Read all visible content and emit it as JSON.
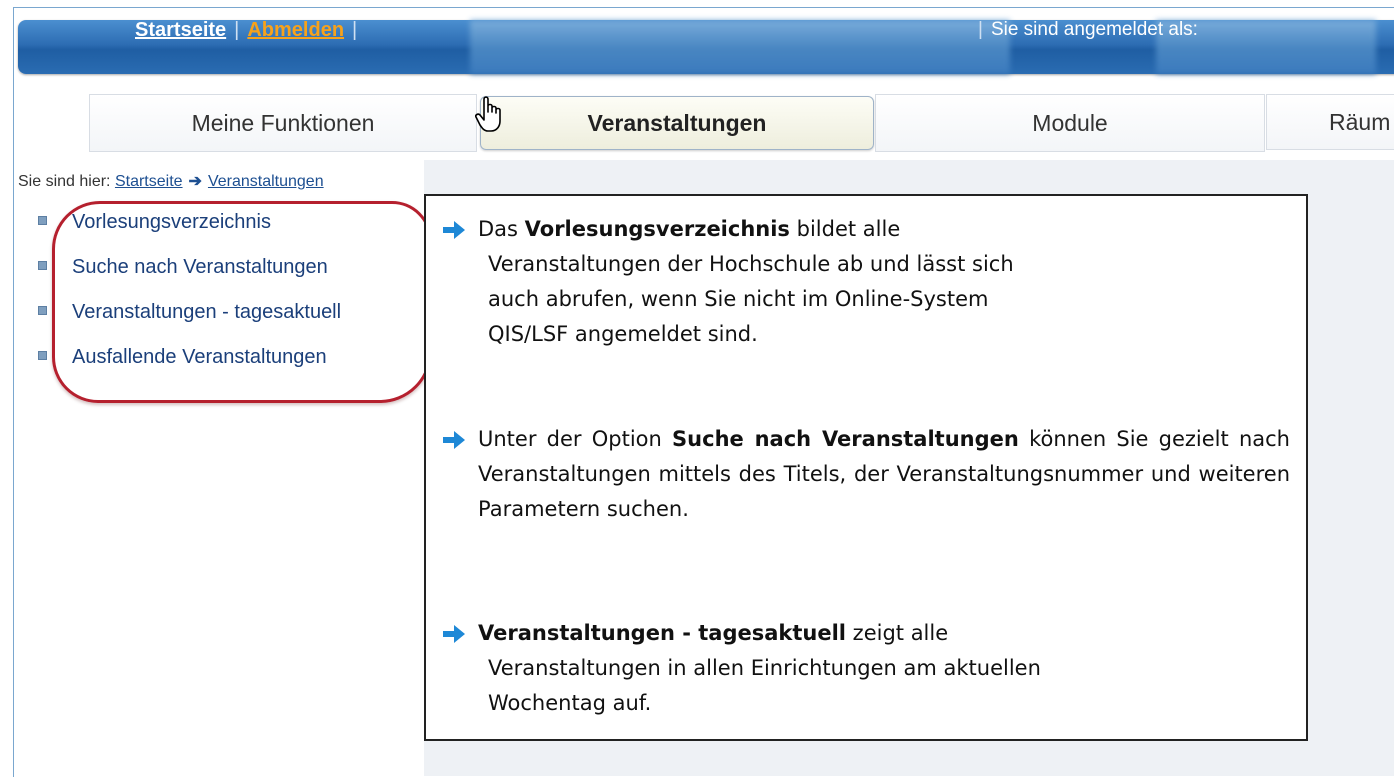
{
  "topbar": {
    "home_label": "Startseite",
    "logout_label": "Abmelden",
    "separator": "|",
    "logged_in_label": "Sie sind angemeldet als:"
  },
  "tabs": [
    {
      "label": "Meine Funktionen",
      "active": false
    },
    {
      "label": "Veranstaltungen",
      "active": true
    },
    {
      "label": "Module",
      "active": false
    },
    {
      "label": "Räum",
      "active": false
    }
  ],
  "breadcrumb": {
    "prefix": "Sie sind hier:",
    "items": [
      "Startseite",
      "Veranstaltungen"
    ]
  },
  "sidebar": {
    "items": [
      {
        "label": "Vorlesungsverzeichnis"
      },
      {
        "label": "Suche nach Veranstaltungen"
      },
      {
        "label": "Veranstaltungen - tagesaktuell"
      },
      {
        "label": "Ausfallende Veranstaltungen"
      }
    ]
  },
  "callout": {
    "p1": {
      "lead": "Das",
      "bold": "Vorlesungsverzeichnis",
      "rest1": "bildet alle",
      "line2": "Veranstaltungen der Hochschule ab und lässt sich",
      "line3": "auch abrufen, wenn Sie nicht im Online-System",
      "line4": "QIS/LSF angemeldet sind."
    },
    "p2": {
      "lead": "Unter der Option",
      "bold": "Suche nach Veranstaltungen",
      "rest": "können Sie gezielt nach Veranstaltungen mittels des Titels, der Veranstaltungsnummer und weiteren Parametern suchen."
    },
    "p3": {
      "bold": "Veranstaltungen - tagesaktuell",
      "rest1": "zeigt alle",
      "line2": "Veranstaltungen in allen Einrichtungen am aktuellen",
      "line3": "Wochentag auf."
    }
  },
  "colors": {
    "topbar_blue": "#2d6db3",
    "logout_orange": "#f7a21b",
    "ring_red": "#b5202e",
    "arrow_blue": "#1e88d6"
  }
}
